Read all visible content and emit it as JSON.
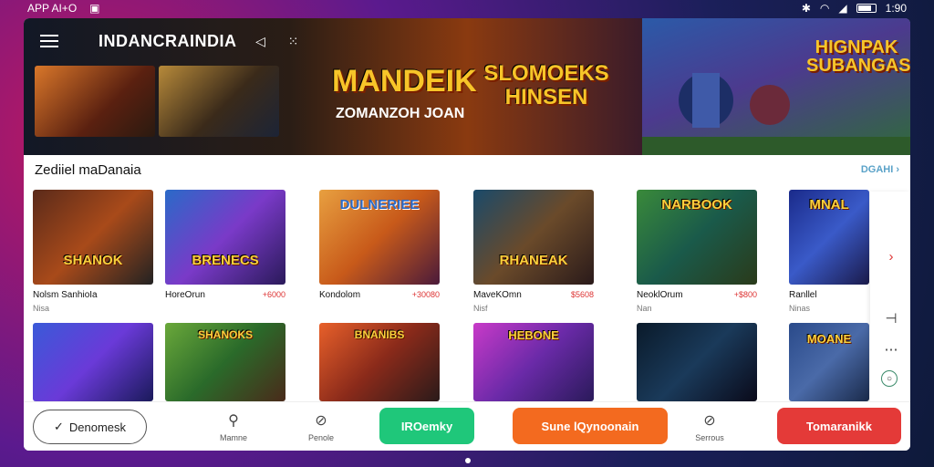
{
  "status_bar": {
    "left_text": "APP AI+O",
    "time": "1:90"
  },
  "header": {
    "title": "INDANCRAINDIA"
  },
  "hero": {
    "banner_title": "MANDEIK",
    "banner_subtitle": "ZOMANZOH JOAN",
    "banner_logo": "SLOMOEKS HINSEN",
    "right_title": "HIGNPAK SUBANGAS"
  },
  "section": {
    "title": "Zediiel maDanaia",
    "see_all": "DGAHI"
  },
  "cards_row1": [
    {
      "logo": "SHANOK",
      "name": "Nolsm SanhioIa",
      "price": "",
      "sub": "Nisa"
    },
    {
      "logo": "BRENECS",
      "name": "HoreOrun",
      "price": "+6000",
      "sub": ""
    },
    {
      "logo": "DULNERIEE",
      "name": "Kondolom",
      "price": "+30080",
      "sub": ""
    },
    {
      "logo": "RHANEAK",
      "name": "MaveKOmn",
      "price": "$5608",
      "sub": "Nisf"
    },
    {
      "logo": "NARBOOK",
      "name": "NeoklOrum",
      "price": "+$800",
      "sub": "Nan"
    },
    {
      "logo": "MNAL",
      "name": "Ranllel",
      "price": "",
      "sub": "Ninas"
    }
  ],
  "cards_row2": [
    {
      "logo": ""
    },
    {
      "logo": "SHANOKS"
    },
    {
      "logo": "BNANIBS"
    },
    {
      "logo": "HEBONE"
    },
    {
      "logo": ""
    },
    {
      "logo": "MOANE"
    }
  ],
  "bottom_bar": {
    "outline_btn": "Denomesk",
    "nav1_label": "Mamne",
    "nav2_label": "Penole",
    "green_btn": "IROemky",
    "orange_btn": "Sune lQynoonain",
    "nav3_label": "Serrous",
    "red_btn": "Tomaranikk"
  },
  "colors": {
    "green": "#1fc77a",
    "orange": "#f36a1f",
    "red": "#e43a38",
    "accent": "#f7c529"
  }
}
